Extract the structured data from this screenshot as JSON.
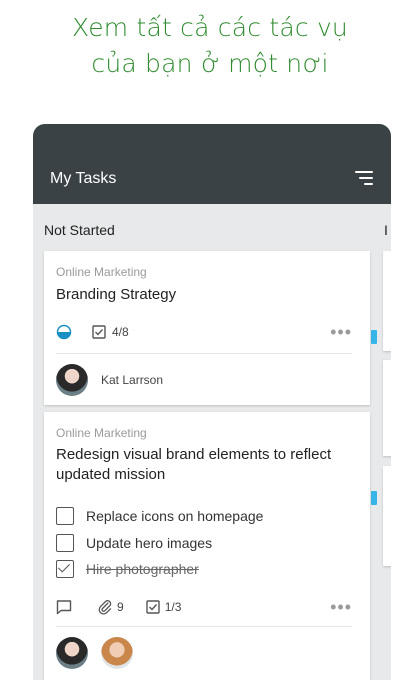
{
  "promo": {
    "line1": "Xem tất cả các tác vụ",
    "line2": "của bạn ở một nơi"
  },
  "appbar": {
    "title": "My Tasks",
    "sort_icon": "sort-icon"
  },
  "columns": [
    {
      "title": "Not Started"
    },
    {
      "title": "I"
    }
  ],
  "cards": [
    {
      "bucket": "Online Marketing",
      "title": "Branding Strategy",
      "progress": "half-complete",
      "checklist_count": "4/8",
      "assignee": "Kat Larrson"
    },
    {
      "bucket": "Online Marketing",
      "title": "Redesign visual brand elements to reflect updated mission",
      "checklist": [
        {
          "label": "Replace icons on homepage",
          "done": false
        },
        {
          "label": "Update hero images",
          "done": false
        },
        {
          "label": "Hire photographer",
          "done": true
        }
      ],
      "attachments": "9",
      "checklist_count": "1/3"
    }
  ],
  "colors": {
    "promo_green": "#2e8b2e",
    "appbar": "#3a4246",
    "progress_blue": "#1a8fc2",
    "accent_cyan": "#35b5e8"
  }
}
